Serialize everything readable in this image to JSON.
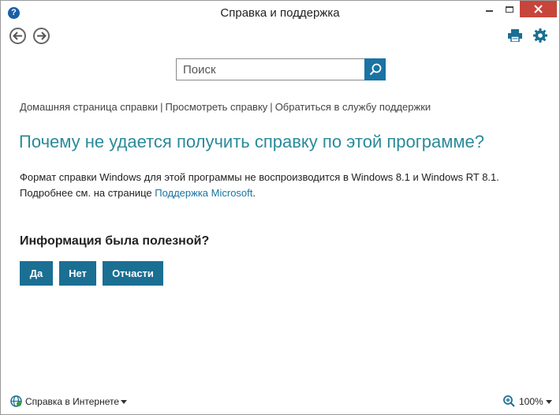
{
  "window": {
    "title": "Справка и поддержка",
    "app_icon_glyph": "?",
    "close_color": "#c7453b"
  },
  "toolbar": {
    "back_icon": "back-arrow-icon",
    "forward_icon": "forward-arrow-icon",
    "print_icon": "print-icon",
    "settings_icon": "gear-icon"
  },
  "search": {
    "placeholder": "Поиск",
    "value": "",
    "button_icon": "search-icon",
    "accent": "#1a73a2"
  },
  "breadcrumb": {
    "items": [
      "Домашняя страница справки",
      "Просмотреть справку",
      "Обратиться в службу поддержки"
    ],
    "separator": "|"
  },
  "main": {
    "title": "Почему не удается получить справку по этой программе?",
    "title_color": "#2a8a9a",
    "line1": "Формат справки Windows для этой программы не воспроизводится в Windows 8.1 и Windows RT 8.1.",
    "line2_prefix": "Подробнее см. на странице ",
    "line2_link": "Поддержка Microsoft",
    "line2_suffix": "."
  },
  "feedback": {
    "question": "Информация была полезной?",
    "yes": "Да",
    "no": "Нет",
    "partly": "Отчасти",
    "button_color": "#1a6f93"
  },
  "statusbar": {
    "online_label": "Справка в Интернете",
    "zoom": "100%"
  }
}
